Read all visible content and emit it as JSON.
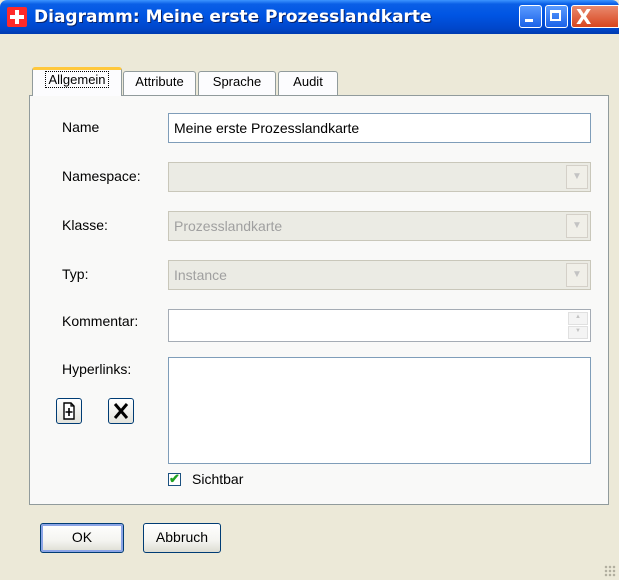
{
  "window": {
    "title": "Diagramm: Meine erste Prozesslandkarte"
  },
  "titlebar_buttons": {
    "minimize_icon": "minimize-icon",
    "maximize_icon": "maximize-icon",
    "close_glyph": "X"
  },
  "tabs": [
    {
      "label": "Allgemein",
      "active": true
    },
    {
      "label": "Attribute",
      "active": false
    },
    {
      "label": "Sprache",
      "active": false
    },
    {
      "label": "Audit",
      "active": false
    }
  ],
  "form": {
    "name": {
      "label": "Name",
      "value": "Meine erste Prozesslandkarte"
    },
    "namespace": {
      "label": "Namespace:",
      "value": ""
    },
    "klasse": {
      "label": "Klasse:",
      "value": "Prozesslandkarte"
    },
    "typ": {
      "label": "Typ:",
      "value": "Instance"
    },
    "kommentar": {
      "label": "Kommentar:",
      "value": ""
    },
    "hyperlinks": {
      "label": "Hyperlinks:"
    },
    "sichtbar": {
      "label": "Sichtbar",
      "checked": true
    }
  },
  "buttons": {
    "ok": "OK",
    "cancel": "Abbruch"
  },
  "colors": {
    "titlebar": "#0054e3",
    "active_tab_accent": "#ffc83c",
    "checkmark": "#21a121"
  }
}
